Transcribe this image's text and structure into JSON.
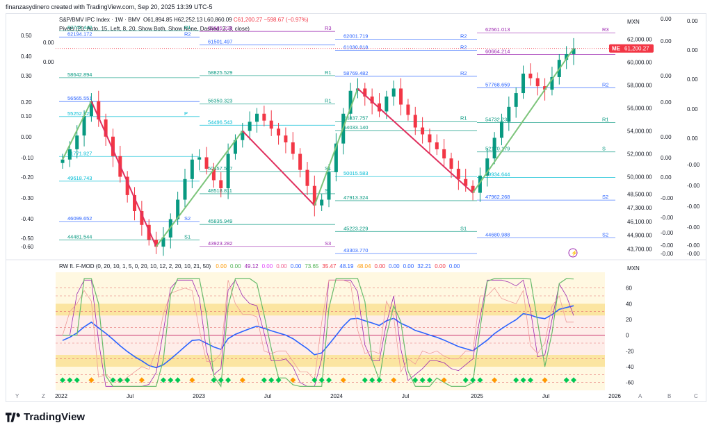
{
  "header": {
    "text": "finanzasydinero created with TradingView.com, Sep 20, 2025 13:39 UTC-5"
  },
  "symbol": {
    "name": "S&P/BMV IPC Index",
    "interval": "1W",
    "exchange": "BMV",
    "open": "O61,894.85",
    "high": "H62,252.13",
    "low": "L60,860.09",
    "close": "C61,200.27",
    "change": "−598.67 (−0.97%)"
  },
  "pivot_legend": "Pivots (20, Auto, 15, Left, 8, 20, Show Both, Show None, Dashed, 2, 3, close)",
  "osc_legend": {
    "title": "RW ft. F-MOD (0, 20, 10, 1, 5, 0, 20, 10, 12, 2, 20, 10, 21, 50)",
    "values": [
      {
        "v": "0.00",
        "c": "#ff9800"
      },
      {
        "v": "0.00",
        "c": "#4caf50"
      },
      {
        "v": "49.12",
        "c": "#9c27b0"
      },
      {
        "v": "0.00",
        "c": "#e040fb"
      },
      {
        "v": "0.00",
        "c": "#f06292"
      },
      {
        "v": "0.00",
        "c": "#2962ff"
      },
      {
        "v": "73.65",
        "c": "#4caf50"
      },
      {
        "v": "35.47",
        "c": "#f23645"
      },
      {
        "v": "48.19",
        "c": "#2962ff"
      },
      {
        "v": "48.04",
        "c": "#ff9800"
      },
      {
        "v": "0.00",
        "c": "#f23645"
      },
      {
        "v": "0.00",
        "c": "#2962ff"
      },
      {
        "v": "0.00",
        "c": "#2962ff"
      },
      {
        "v": "32.21",
        "c": "#2962ff"
      },
      {
        "v": "0.00",
        "c": "#f23645"
      },
      {
        "v": "0.00",
        "c": "#2962ff"
      }
    ]
  },
  "currency": "MXN",
  "osc_currency": "MXN",
  "price_tag": {
    "label": "ME",
    "value": "61,200.27",
    "color": "#f23645"
  },
  "brand": {
    "name": "TradingView"
  },
  "corner_buttons": {
    "log": "A",
    "b": "B",
    "c": "C",
    "y": "Y",
    "z": "Z"
  },
  "chart_data": {
    "type": "candlestick",
    "price_axis": [
      "62,000.00",
      "60,000.00",
      "58,000.00",
      "56,000.00",
      "54,000.00",
      "52,000.00",
      "50,000.00",
      "48,500.00",
      "47,300.00",
      "46,100.00",
      "44,900.00",
      "43,700.00"
    ],
    "time_axis": [
      "2022",
      "Jul",
      "2023",
      "Jul",
      "2024",
      "Jul",
      "2025",
      "Jul",
      "2026"
    ],
    "close_series": [
      51500,
      52400,
      53600,
      55300,
      56600,
      55000,
      53500,
      51800,
      50000,
      48400,
      47000,
      45800,
      44500,
      43900,
      44700,
      46300,
      48000,
      49800,
      51500,
      51700,
      50700,
      49700,
      49000,
      52000,
      53200,
      54000,
      54800,
      55500,
      54900,
      54200,
      53600,
      53000,
      52000,
      50600,
      49200,
      47500,
      48000,
      50400,
      52900,
      55500,
      57500,
      57700,
      57000,
      56400,
      55700,
      57000,
      57700,
      56300,
      55400,
      54300,
      53700,
      53000,
      52400,
      51600,
      50700,
      49800,
      49200,
      48600,
      50100,
      51600,
      53400,
      54800,
      56100,
      57300,
      59000,
      58600,
      57900,
      57600,
      58700,
      60200,
      60700,
      61200
    ],
    "pivot_levels": [
      {
        "label": "R1",
        "value": "62743.440",
        "color": "#089981"
      },
      {
        "label": "R3",
        "value": "62685.238",
        "color": "#9c27b0"
      },
      {
        "label": "R2",
        "value": "62001.719",
        "color": "#2962ff"
      },
      {
        "label": "R3",
        "value": "62561.013",
        "color": "#9c27b0"
      },
      {
        "label": "R2",
        "value": "62194.172",
        "color": "#2962ff"
      },
      {
        "label": "",
        "value": "61501.497",
        "color": "#2962ff"
      },
      {
        "label": "R2",
        "value": "61030.818",
        "color": "#2962ff"
      },
      {
        "label": "",
        "value": "60664.214",
        "color": "#9c27b0"
      },
      {
        "label": "",
        "value": "58642.894",
        "color": "#089981"
      },
      {
        "label": "R1",
        "value": "58825.529",
        "color": "#089981"
      },
      {
        "label": "R2",
        "value": "58769.482",
        "color": "#2962ff"
      },
      {
        "label": "R2",
        "value": "57768.659",
        "color": "#2962ff"
      },
      {
        "label": "",
        "value": "56565.551",
        "color": "#2962ff"
      },
      {
        "label": "R1",
        "value": "56350.323",
        "color": "#089981"
      },
      {
        "label": "R1",
        "value": "54837.757",
        "color": "#089981"
      },
      {
        "label": "R1",
        "value": "54732.235",
        "color": "#089981"
      },
      {
        "label": "P",
        "value": "55252.329",
        "color": "#00bcd4"
      },
      {
        "label": "",
        "value": "54496.543",
        "color": "#00bcd4"
      },
      {
        "label": "",
        "value": "54033.140",
        "color": "#089981"
      },
      {
        "label": "S",
        "value": "52170.179",
        "color": "#089981"
      },
      {
        "label": "",
        "value": "51771.927",
        "color": "#00bcd4"
      },
      {
        "label": "S1",
        "value": "50457.557",
        "color": "#089981"
      },
      {
        "label": "",
        "value": "50015.583",
        "color": "#00bcd4"
      },
      {
        "label": "",
        "value": "49934.644",
        "color": "#00bcd4"
      },
      {
        "label": "",
        "value": "49618.743",
        "color": "#00bcd4"
      },
      {
        "label": "S1",
        "value": "48518.811",
        "color": "#089981"
      },
      {
        "label": "",
        "value": "47913.324",
        "color": "#089981"
      },
      {
        "label": "S2",
        "value": "47962.268",
        "color": "#2962ff"
      },
      {
        "label": "S2",
        "value": "46099.652",
        "color": "#2962ff"
      },
      {
        "label": "",
        "value": "45835.949",
        "color": "#089981"
      },
      {
        "label": "S1",
        "value": "45223.229",
        "color": "#089981"
      },
      {
        "label": "S2",
        "value": "44680.988",
        "color": "#2962ff"
      },
      {
        "label": "S1",
        "value": "44481.544",
        "color": "#089981"
      },
      {
        "label": "S3",
        "value": "43923.282",
        "color": "#9c27b0"
      },
      {
        "label": "",
        "value": "43303.770",
        "color": "#2962ff"
      }
    ],
    "left_scale": [
      "0.50",
      "0.40",
      "0.30",
      "0.20",
      "0.10",
      "0.00",
      "-0.10",
      "-0.20",
      "-0.30",
      "-0.40",
      "-0.50",
      "-0.60",
      "0.00",
      "0.00"
    ],
    "right_scale_a": [
      "0.00",
      "0.00",
      "0.00",
      "0.00",
      "0.00",
      "0.00",
      "0.00",
      "-0.00",
      "-0.00",
      "-0.00",
      "-0.00",
      "-0.00"
    ],
    "right_scale_b": [
      "0.00",
      "0.00",
      "0.00",
      "0.00",
      "0.00",
      "-0.00",
      "-0.00",
      "-0.00",
      "-0.00",
      "-0.00",
      "-0.00",
      "-0.00"
    ],
    "osc_axis": [
      "60",
      "40",
      "20",
      "0",
      "-20",
      "-40",
      "-60"
    ]
  }
}
